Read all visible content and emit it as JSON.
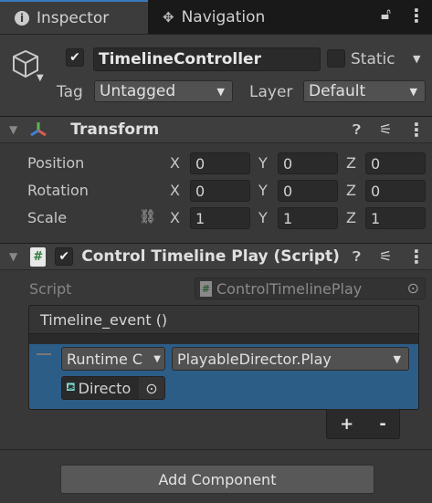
{
  "tabs": [
    {
      "label": "Inspector",
      "icon": "info-icon",
      "active": true
    },
    {
      "label": "Navigation",
      "icon": "navigation-icon",
      "active": false
    }
  ],
  "gameobject": {
    "name": "TimelineController",
    "active": true,
    "static_label": "Static",
    "static": false,
    "tag_label": "Tag",
    "tag": "Untagged",
    "layer_label": "Layer",
    "layer": "Default"
  },
  "transform": {
    "title": "Transform",
    "rows": [
      {
        "label": "Position",
        "x": "0",
        "y": "0",
        "z": "0"
      },
      {
        "label": "Rotation",
        "x": "0",
        "y": "0",
        "z": "0"
      },
      {
        "label": "Scale",
        "x": "1",
        "y": "1",
        "z": "1"
      }
    ],
    "axes": {
      "x": "X",
      "y": "Y",
      "z": "Z"
    }
  },
  "script": {
    "title": "Control Timeline Play (Script)",
    "enabled": true,
    "script_label": "Script",
    "script_value": "ControlTimelinePlay",
    "event": {
      "header": "Timeline_event ()",
      "runtime": "Runtime C",
      "function": "PlayableDirector.Play",
      "target": "Directo"
    }
  },
  "buttons": {
    "add": "+",
    "remove": "-",
    "add_component": "Add Component"
  },
  "colors": {
    "selection": "#2c5d87",
    "tab_accent": "#3a79bb"
  }
}
